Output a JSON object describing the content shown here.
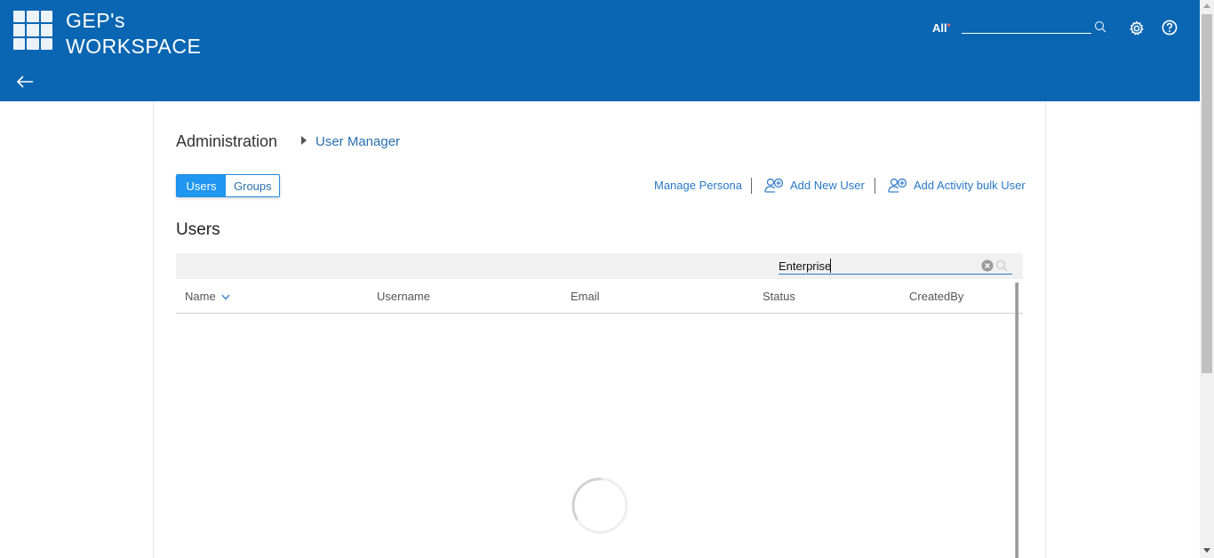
{
  "header": {
    "brand_line1": "GEP's",
    "brand_line2": "WORKSPACE",
    "scope_label": "All",
    "search_placeholder": "",
    "colors": {
      "bar": "#0a66b2",
      "accent": "#1f96f0"
    }
  },
  "breadcrumb": {
    "root": "Administration",
    "current": "User Manager"
  },
  "toggle": {
    "users_label": "Users",
    "groups_label": "Groups",
    "selected": "Users"
  },
  "actions": {
    "manage_persona": "Manage Persona",
    "add_new_user": "Add New User",
    "add_bulk_user": "Add Activity bulk User"
  },
  "section": {
    "title": "Users"
  },
  "filter": {
    "value": "Enterprise"
  },
  "table": {
    "columns": [
      "Name",
      "Username",
      "Email",
      "Status",
      "CreatedBy"
    ],
    "sorted_column": "Name",
    "sort_direction": "descending",
    "rows": [],
    "loading": true
  },
  "icons": {
    "logo": "grid-logo-icon",
    "search": "search-icon",
    "settings": "gear-icon",
    "help": "help-icon",
    "back": "back-arrow-icon",
    "add_user": "add-user-icon",
    "clear": "clear-icon",
    "sort": "chevron-down-icon",
    "loading": "spinner-icon"
  }
}
